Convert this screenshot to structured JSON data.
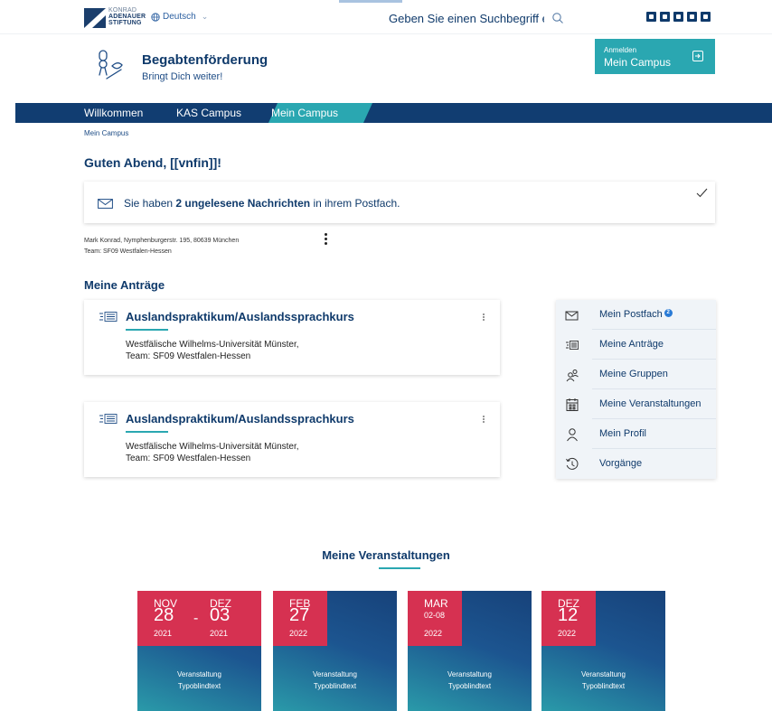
{
  "topbar": {
    "logo": {
      "line1": "KONRAD",
      "line2": "ADENAUER",
      "line3": "STIFTUNG"
    },
    "language": "Deutsch",
    "search_placeholder": "Geben Sie einen Suchbegriff ein",
    "social_icons": [
      "facebook-icon",
      "youtube-icon",
      "twitter-icon",
      "instagram-icon",
      "rss-icon"
    ]
  },
  "header": {
    "title": "Begabtenförderung",
    "subtitle": "Bringt Dich weiter!",
    "login": {
      "small": "Anmelden",
      "big": "Mein Campus"
    }
  },
  "nav": {
    "items": [
      {
        "label": "Willkommen"
      },
      {
        "label": "KAS Campus"
      },
      {
        "label": "Mein Campus",
        "active": true
      }
    ]
  },
  "breadcrumb": "Mein Campus",
  "greeting": "Guten Abend, [[vnfin]]!",
  "notice": {
    "before": "Sie haben ",
    "bold": "2 ungelesene Nachrichten",
    "after": " in ihrem Postfach."
  },
  "profile": {
    "address": "Mark Konrad, Nymphenburgerstr. 195, 80639 München",
    "team": "Team: SF09 Westfalen-Hessen"
  },
  "applications": {
    "title": "Meine Anträge",
    "items": [
      {
        "title": "Auslandspraktikum/Auslandssprachkurs",
        "line1": "Westfälische Wilhelms-Universität Münster,",
        "line2": "Team: SF09 Westfalen-Hessen"
      },
      {
        "title": "Auslandspraktikum/Auslandssprachkurs",
        "line1": "Westfälische Wilhelms-Universität Münster,",
        "line2": "Team: SF09 Westfalen-Hessen"
      }
    ]
  },
  "side_menu": {
    "items": [
      {
        "label": "Mein Postfach",
        "icon": "mail-icon",
        "badge": "2"
      },
      {
        "label": "Meine Anträge",
        "icon": "application-icon"
      },
      {
        "label": "Meine Gruppen",
        "icon": "group-icon"
      },
      {
        "label": "Meine Veranstaltungen",
        "icon": "calendar-icon"
      },
      {
        "label": "Mein Profil",
        "icon": "profile-icon"
      },
      {
        "label": "Vorgänge",
        "icon": "history-icon"
      }
    ]
  },
  "events": {
    "title": "Meine Veranstaltungen",
    "items": [
      {
        "mon1": "NOV",
        "day1": "28",
        "yr1": "2021",
        "mon2": "DEZ",
        "day2": "03",
        "yr2": "2021",
        "line1": "Veranstaltung",
        "line2": "Typoblindtext"
      },
      {
        "mon1": "FEB",
        "day1": "27",
        "yr1": "2022",
        "line1": "Veranstaltung",
        "line2": "Typoblindtext"
      },
      {
        "mon1": "MAR",
        "range": "02-08",
        "yr1": "2022",
        "line1": "Veranstaltung",
        "line2": "Typoblindtext"
      },
      {
        "mon1": "DEZ",
        "day1": "12",
        "yr1": "2022",
        "line1": "Veranstaltung",
        "line2": "Typoblindtext"
      }
    ]
  },
  "colors": {
    "navy": "#113d71",
    "teal": "#2aa7b1",
    "red": "#d63151"
  }
}
